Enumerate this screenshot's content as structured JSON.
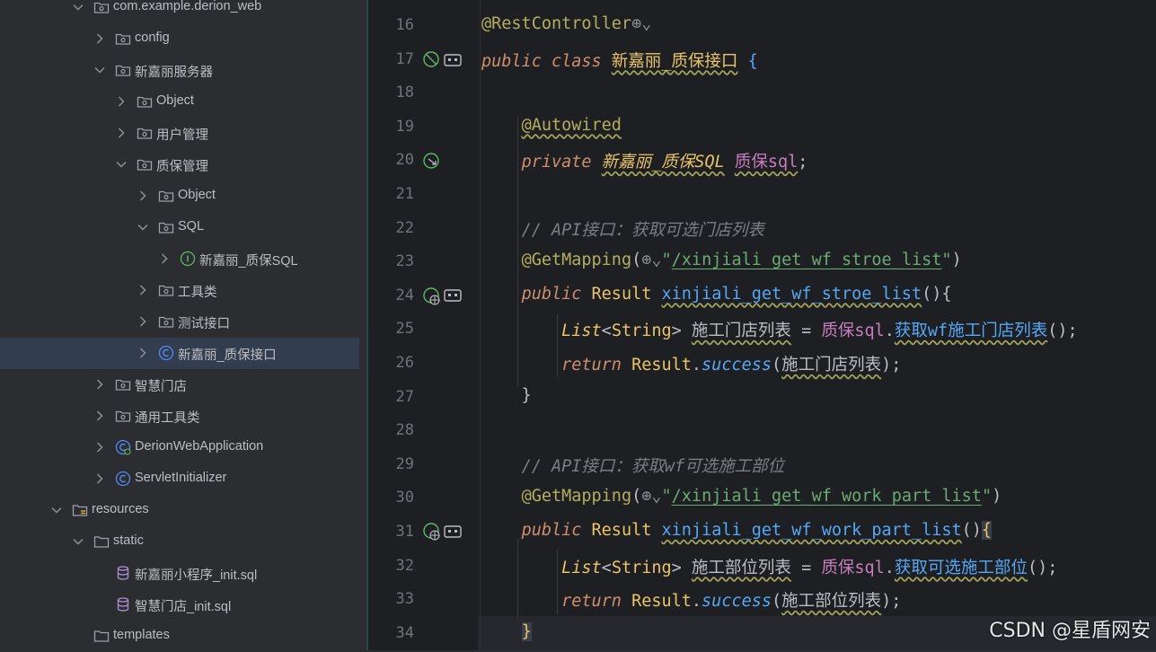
{
  "tree": {
    "items": [
      {
        "label": "com.example.derion_web",
        "indent": 0,
        "expanded": true,
        "icon": "package-icon"
      },
      {
        "label": "config",
        "indent": 1,
        "expanded": false,
        "icon": "package-icon"
      },
      {
        "label": "新嘉丽服务器",
        "indent": 1,
        "expanded": true,
        "icon": "package-icon"
      },
      {
        "label": "Object",
        "indent": 2,
        "expanded": false,
        "icon": "package-icon"
      },
      {
        "label": "用户管理",
        "indent": 2,
        "expanded": false,
        "icon": "package-icon"
      },
      {
        "label": "质保管理",
        "indent": 2,
        "expanded": true,
        "icon": "package-icon"
      },
      {
        "label": "Object",
        "indent": 3,
        "expanded": false,
        "icon": "package-icon"
      },
      {
        "label": "SQL",
        "indent": 3,
        "expanded": true,
        "icon": "package-icon"
      },
      {
        "label": "新嘉丽_质保SQL",
        "indent": 4,
        "expanded": false,
        "icon": "interface-icon"
      },
      {
        "label": "工具类",
        "indent": 3,
        "expanded": false,
        "icon": "package-icon"
      },
      {
        "label": "测试接口",
        "indent": 3,
        "expanded": false,
        "icon": "package-icon"
      },
      {
        "label": "新嘉丽_质保接口",
        "indent": 3,
        "expanded": false,
        "icon": "class-icon",
        "selected": true
      },
      {
        "label": "智慧门店",
        "indent": 1,
        "expanded": false,
        "icon": "package-icon"
      },
      {
        "label": "通用工具类",
        "indent": 1,
        "expanded": false,
        "icon": "package-icon"
      },
      {
        "label": "DerionWebApplication",
        "indent": 1,
        "expanded": false,
        "icon": "spring-class-icon"
      },
      {
        "label": "ServletInitializer",
        "indent": 1,
        "expanded": false,
        "icon": "class-icon"
      },
      {
        "label": "resources",
        "indent": -1,
        "expanded": true,
        "icon": "resources-folder-icon"
      },
      {
        "label": "static",
        "indent": 0,
        "expanded": true,
        "icon": "folder-icon"
      },
      {
        "label": "新嘉丽小程序_init.sql",
        "indent": 1,
        "leaf": true,
        "icon": "database-icon"
      },
      {
        "label": "智慧门店_init.sql",
        "indent": 1,
        "leaf": true,
        "icon": "database-icon"
      },
      {
        "label": "templates",
        "indent": 0,
        "leaf": true,
        "icon": "folder-icon"
      }
    ]
  },
  "editor": {
    "lines": [
      {
        "n": "16",
        "html": "<span class=\"ann\">@RestController</span><span style=\"color:#8c8f94\">⊕⌄</span>"
      },
      {
        "n": "17",
        "html": "<span class=\"kw\">public class</span> <span class=\"cls ul\">新嘉丽_质保接口</span> <span style=\"color:#56a8f5\">{</span>"
      },
      {
        "n": "18",
        "html": ""
      },
      {
        "n": "19",
        "html": "    <span class=\"ann ul\">@Autowired</span>"
      },
      {
        "n": "20",
        "html": "    <span class=\"kw\">private</span> <span class=\"cls ul\" style=\"font-style:italic\">新嘉丽_质保SQL</span> <span class=\"type ul\">质保sql</span>;"
      },
      {
        "n": "21",
        "html": ""
      },
      {
        "n": "22",
        "html": "    <span class=\"cm\">// API接口：获取可选门店列表</span>"
      },
      {
        "n": "23",
        "html": "    <span class=\"ann\">@GetMapping</span>(<span style=\"color:#8c8f94\">⊕⌄</span><span class=\"str\">\"<span class=\"ulb\">/xinjiali_get_wf_stroe_list</span>\"</span>)"
      },
      {
        "n": "24",
        "html": "    <span class=\"kw\">public</span> <span class=\"cls\">Result</span> <span class=\"fn ul\">xinjiali_get_wf_stroe_list</span>(){"
      },
      {
        "n": "25",
        "html": "        <span class=\"cls\" style=\"font-style:italic\">List</span>&lt;<span class=\"cls\">String</span>&gt; <span class=\"ul\">施工门店列表</span> = <span class=\"type\">质保sql</span>.<span class=\"fn ul\">获取wf施工门店列表</span>();"
      },
      {
        "n": "26",
        "html": "        <span class=\"kw\">return</span> <span class=\"cls\">Result</span>.<span class=\"fn\" style=\"font-style:italic\">success</span>(<span class=\"ul\">施工门店列表</span>);"
      },
      {
        "n": "27",
        "html": "    }"
      },
      {
        "n": "28",
        "html": ""
      },
      {
        "n": "29",
        "html": "    <span class=\"cm\">// API接口：获取wf可选施工部位</span>"
      },
      {
        "n": "30",
        "html": "    <span class=\"ann\">@GetMapping</span>(<span style=\"color:#8c8f94\">⊕⌄</span><span class=\"str\">\"<span class=\"ulb\">/xinjiali_get_wf_work_part_list</span>\"</span>)"
      },
      {
        "n": "31",
        "html": "    <span class=\"kw\">public</span> <span class=\"cls\">Result</span> <span class=\"fn ul\">xinjiali_get_wf_work_part_list</span>()<span style=\"color:#e8c46a;background:#3b3f4a\">{</span>"
      },
      {
        "n": "32",
        "html": "        <span class=\"cls\" style=\"font-style:italic\">List</span>&lt;<span class=\"cls\">String</span>&gt; <span class=\"ul\">施工部位列表</span> = <span class=\"type\">质保sql</span>.<span class=\"fn ul\">获取可选施工部位</span>();"
      },
      {
        "n": "33",
        "html": "        <span class=\"kw\">return</span> <span class=\"cls\">Result</span>.<span class=\"fn\" style=\"font-style:italic\">success</span>(<span class=\"ul\">施工部位列表</span>);"
      },
      {
        "n": "34",
        "html": "    <span style=\"color:#e8c46a;background:#3b3f4a\">}</span>"
      }
    ]
  },
  "watermark": "CSDN @星盾网安"
}
